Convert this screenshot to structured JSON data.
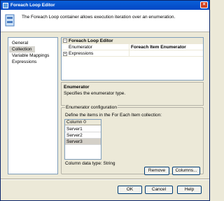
{
  "window": {
    "title": "Foreach Loop Editor",
    "close_glyph": "×"
  },
  "header": {
    "text": "The Foreach Loop container allows execution iteration over an enumeration."
  },
  "nav": {
    "items": [
      {
        "label": "General"
      },
      {
        "label": "Collection"
      },
      {
        "label": "Variable Mappings"
      },
      {
        "label": "Expressions"
      }
    ],
    "selected_index": 1
  },
  "property_grid": {
    "category": "Foreach Loop Editor",
    "category_expander": "−",
    "rows": [
      {
        "name": "Enumerator",
        "value": "Foreach Item Enumerator"
      },
      {
        "name": "Expressions",
        "value": "",
        "expander": "+"
      }
    ]
  },
  "description": {
    "title": "Enumerator",
    "text": "Specifies the enumerator type."
  },
  "config": {
    "title": "Enumerator configuration",
    "instruction": "Define the items in the For Each Item collection:",
    "column_header": "Column 0",
    "items": [
      "Server1",
      "Server2",
      "Server3"
    ],
    "selected_index": 2,
    "footer": "Column data type: String",
    "remove_label": "Remove",
    "columns_label": "Columns..."
  },
  "buttons": {
    "ok": "OK",
    "cancel": "Cancel",
    "help": "Help"
  }
}
